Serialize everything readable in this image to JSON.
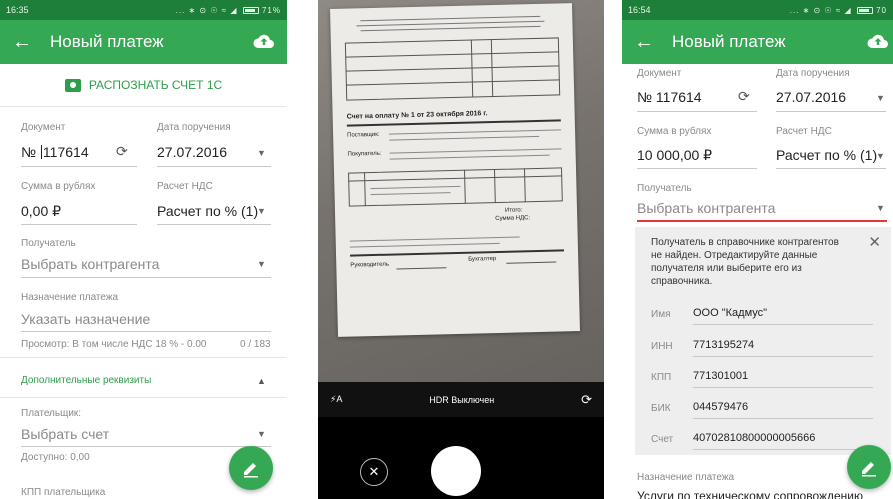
{
  "phone1": {
    "status": {
      "time": "16:35",
      "icons": "... ∗ ⊙ ☉ ≈ ◢",
      "battery": "71%"
    },
    "appbar": {
      "title": "Новый платеж"
    },
    "recognize_label": "РАСПОЗНАТЬ СЧЕТ 1С",
    "document": {
      "label": "Документ",
      "prefix": "№",
      "value_start": "1",
      "value_rest": "17614"
    },
    "date": {
      "label": "Дата поручения",
      "value": "27.07.2016"
    },
    "amount": {
      "label": "Сумма в рублях",
      "value": "0,00 ₽"
    },
    "vat": {
      "label": "Расчет НДС",
      "value": "Расчет по % (1)"
    },
    "recipient": {
      "label": "Получатель",
      "placeholder": "Выбрать контрагента"
    },
    "purpose": {
      "label": "Назначение платежа",
      "placeholder": "Указать назначение"
    },
    "preview": {
      "text": "Просмотр: В том числе НДС 18 % - 0.00",
      "counter": "0 / 183"
    },
    "extra": {
      "label": "Дополнительные реквизиты"
    },
    "payer": {
      "label": "Плательщик:",
      "placeholder": "Выбрать счет",
      "available": "Доступно: 0,00"
    },
    "kpp_payer": {
      "label": "КПП плательщика"
    }
  },
  "phone2": {
    "hdr_label": "HDR Выключен",
    "flash_label": "⚡A",
    "paper": {
      "heading": "Счет на оплату № 1 от 23 октября 2016 г.",
      "supplier_tag": "Поставщик:",
      "buyer_tag": "Покупатель:",
      "total_label": "Итого:",
      "vat_label": "Сумма НДС:",
      "manager_label": "Руководитель",
      "accountant_label": "Бухгалтер"
    }
  },
  "phone3": {
    "status": {
      "time": "16:54",
      "icons": "... ∗ ⊙ ☉ ≈ ◢",
      "battery": "70"
    },
    "appbar": {
      "title": "Новый платеж"
    },
    "document": {
      "label": "Документ",
      "value": "№ 117614"
    },
    "date": {
      "label": "Дата поручения",
      "value": "27.07.2016"
    },
    "amount": {
      "label": "Сумма в рублях",
      "value": "10 000,00 ₽"
    },
    "vat": {
      "label": "Расчет НДС",
      "value": "Расчет по % (1)"
    },
    "recipient": {
      "label": "Получатель",
      "placeholder": "Выбрать контрагента"
    },
    "notice": {
      "text": "Получатель в справочнике контрагентов не найден. Отредактируйте данные получателя или выберите его из справочника.",
      "fields": [
        {
          "label": "Имя",
          "value": "ООО \"Кадмус\""
        },
        {
          "label": "ИНН",
          "value": "7713195274"
        },
        {
          "label": "КПП",
          "value": "771301001"
        },
        {
          "label": "БИК",
          "value": "044579476"
        },
        {
          "label": "Счет",
          "value": "40702810800000005666"
        }
      ]
    },
    "purpose": {
      "label": "Назначение платежа",
      "value": "Услуги по техническому сопровождению"
    }
  },
  "colors": {
    "primary": "#34a853",
    "status": "#1e7f3a",
    "error_line": "#e53935"
  }
}
